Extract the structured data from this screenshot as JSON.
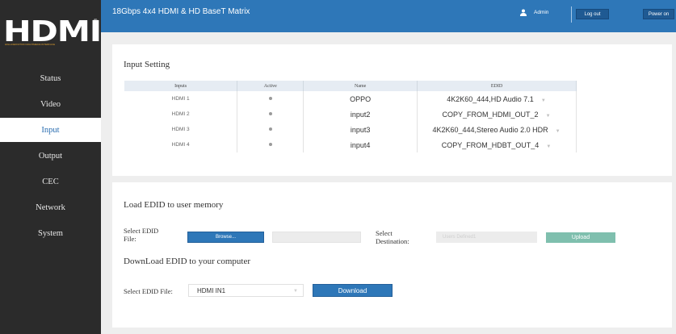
{
  "app": {
    "title": "18Gbps 4x4 HDMI & HD BaseT Matrix",
    "user": "Admin",
    "logout_label": "Log out",
    "power_label": "Power on",
    "brand": "HDMI",
    "brand_tagline": "HIGH-DEFINITION MULTIMEDIA INTERFACE"
  },
  "nav": {
    "items": [
      {
        "label": "Status"
      },
      {
        "label": "Video"
      },
      {
        "label": "Input"
      },
      {
        "label": "Output"
      },
      {
        "label": "CEC"
      },
      {
        "label": "Network"
      },
      {
        "label": "System"
      }
    ],
    "active": "Input"
  },
  "input_setting": {
    "title": "Input Setting",
    "columns": [
      "Inputs",
      "Active",
      "Name",
      "EDID"
    ],
    "rows": [
      {
        "input": "HDMI 1",
        "name": "OPPO",
        "edid": "4K2K60_444,HD Audio 7.1"
      },
      {
        "input": "HDMI 2",
        "name": "input2",
        "edid": "COPY_FROM_HDMI_OUT_2"
      },
      {
        "input": "HDMI 3",
        "name": "input3",
        "edid": "4K2K60_444,Stereo Audio 2.0 HDR"
      },
      {
        "input": "HDMI 4",
        "name": "input4",
        "edid": "COPY_FROM_HDBT_OUT_4"
      }
    ]
  },
  "load_edid": {
    "title": "Load EDID to user memory",
    "file_label_1": "Select EDID",
    "file_label_2": "File:",
    "browse_label": "Browse...",
    "dest_label_1": "Select",
    "dest_label_2": "Destination:",
    "dest_placeholder": "Users Defined1",
    "upload_label": "Upload"
  },
  "download_edid": {
    "title": "DownLoad EDID to your computer",
    "file_label": "Select EDID File:",
    "selected": "HDMI IN1",
    "download_label": "Download"
  },
  "colors": {
    "accent": "#2e77b8",
    "sidebar": "#2b2b2b",
    "upload": "#7fbfae"
  }
}
